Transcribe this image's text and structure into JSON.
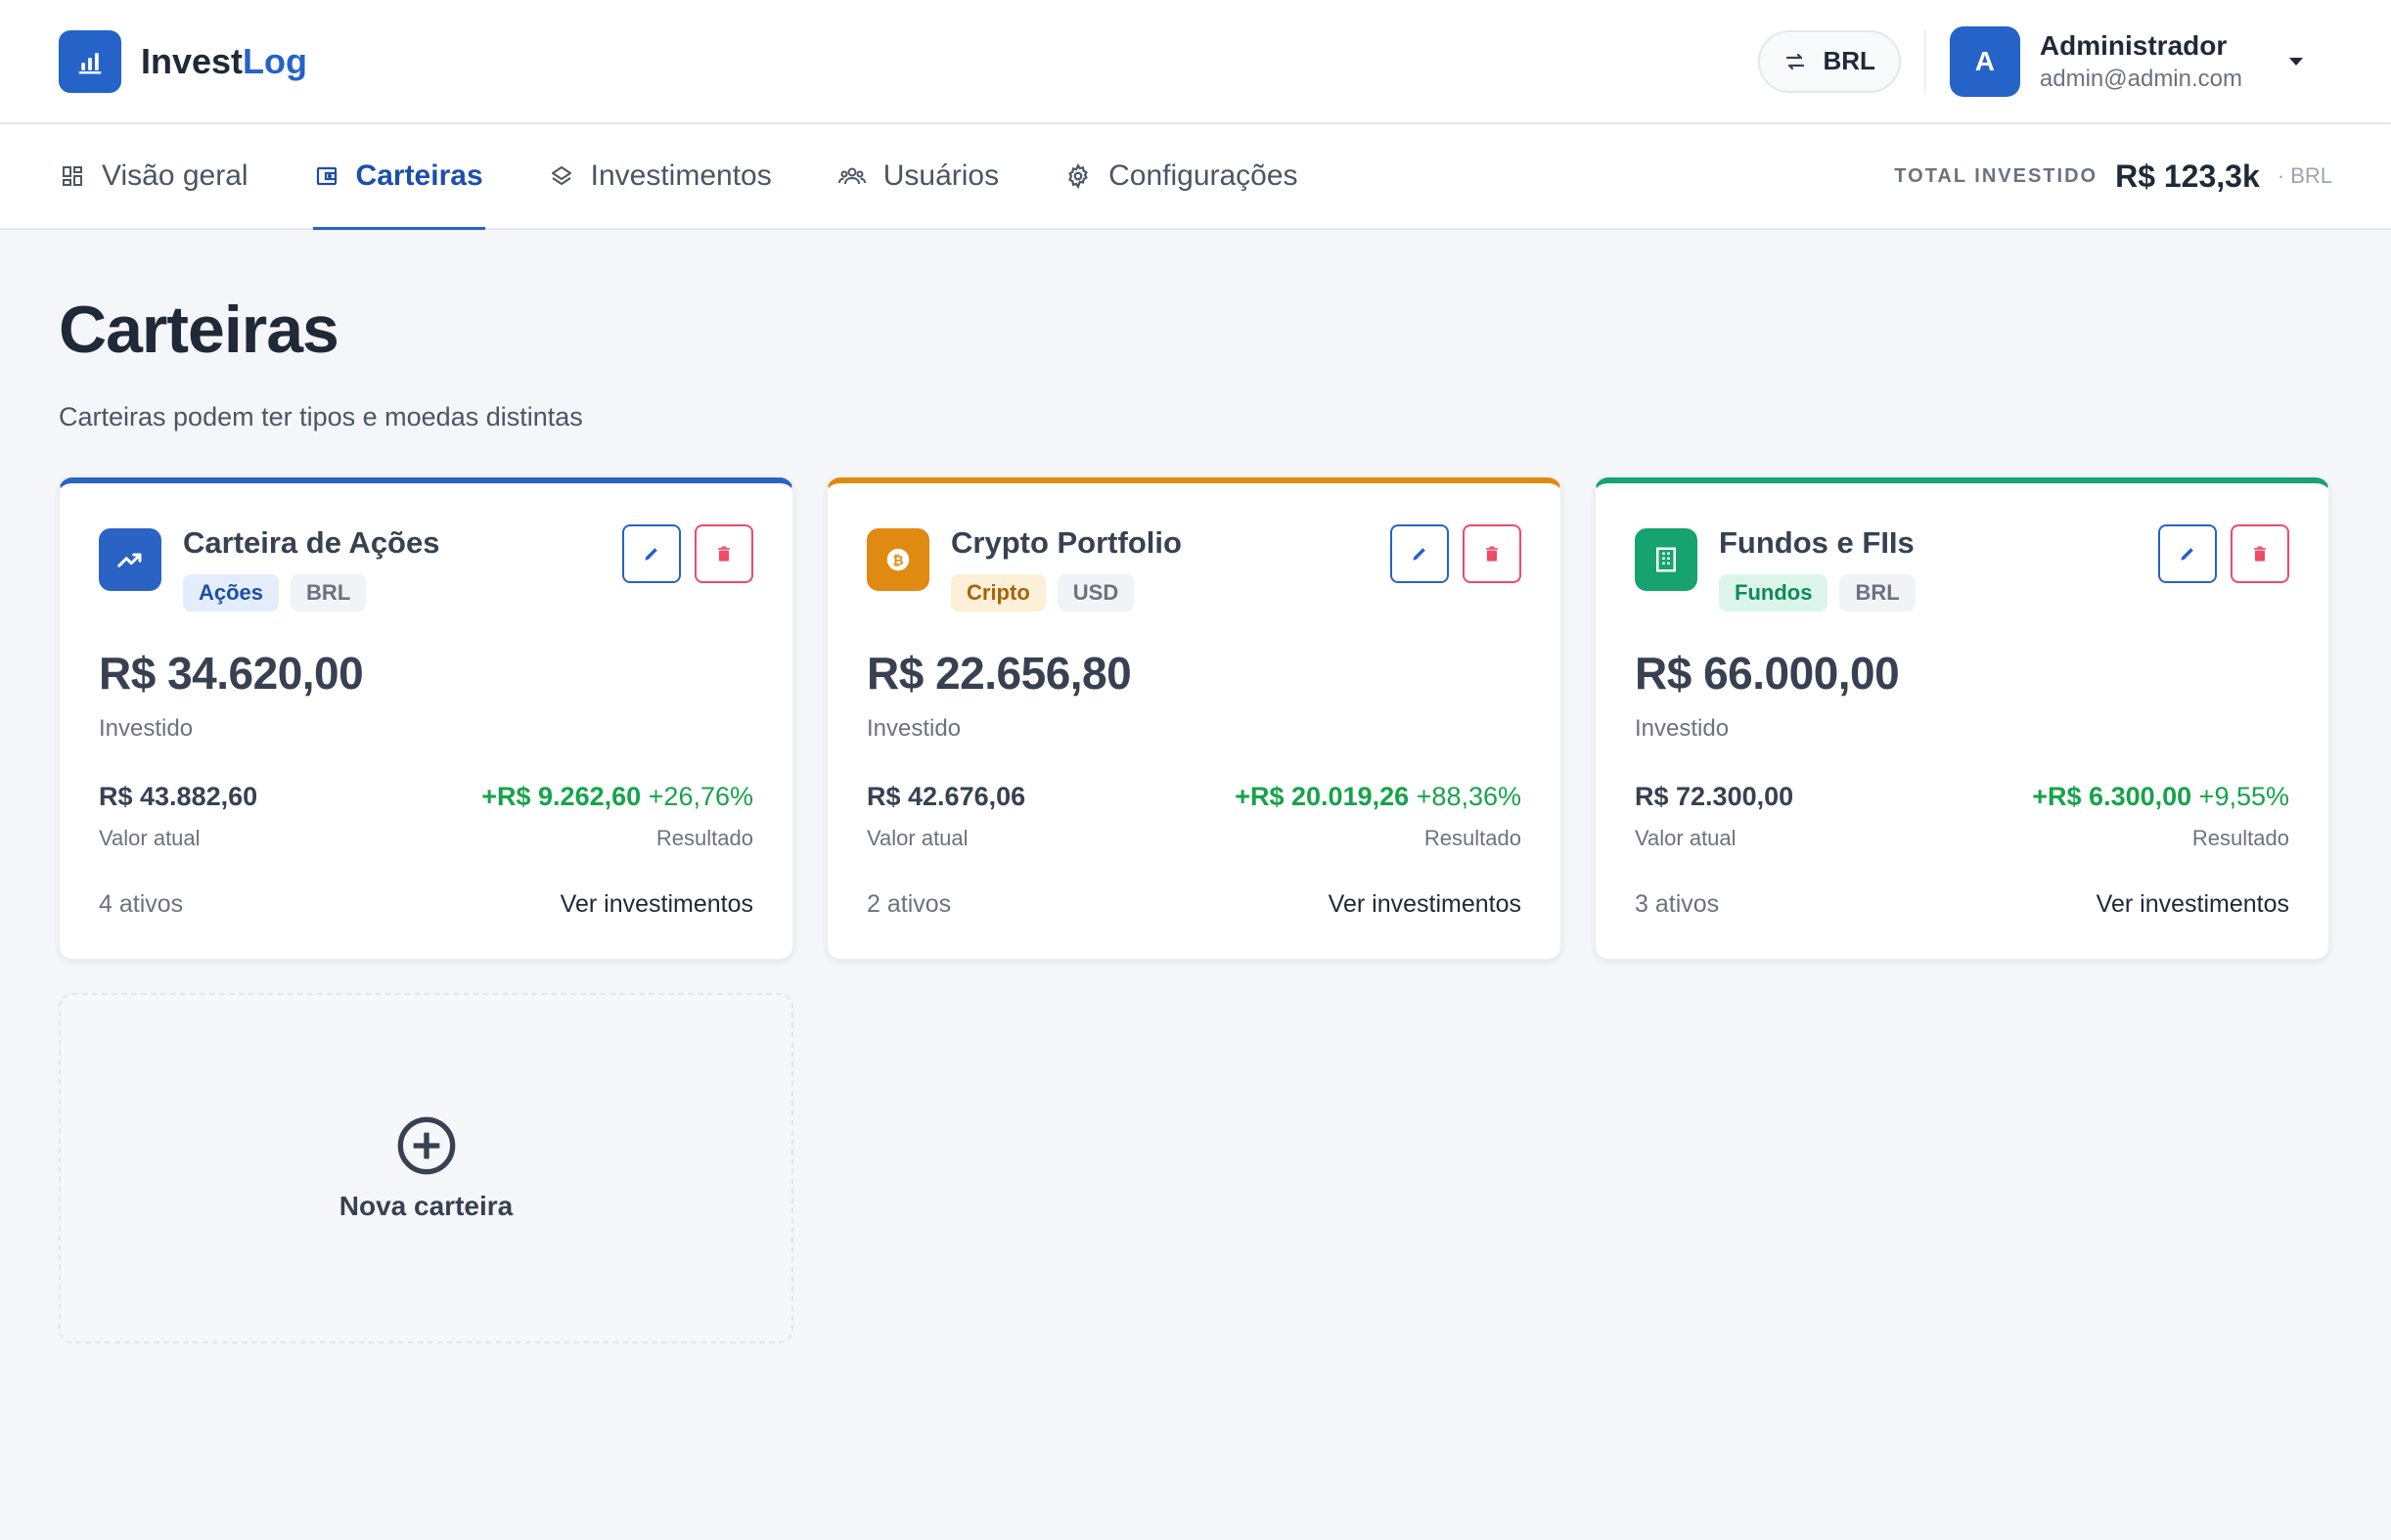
{
  "app": {
    "name_prefix": "Invest",
    "name_accent": "Log"
  },
  "header": {
    "currency_label": "BRL",
    "user": {
      "initial": "A",
      "name": "Administrador",
      "email": "admin@admin.com"
    }
  },
  "nav": {
    "tabs": [
      {
        "label": "Visão geral",
        "icon": "dashboard-icon",
        "active": false
      },
      {
        "label": "Carteiras",
        "icon": "wallet-icon",
        "active": true
      },
      {
        "label": "Investimentos",
        "icon": "layers-icon",
        "active": false
      },
      {
        "label": "Usuários",
        "icon": "users-icon",
        "active": false
      },
      {
        "label": "Configurações",
        "icon": "gear-icon",
        "active": false
      }
    ],
    "total_label": "TOTAL INVESTIDO",
    "total_value": "R$ 123,3k",
    "total_currency": "· BRL"
  },
  "page": {
    "title": "Carteiras",
    "subtitle": "Carteiras podem ter tipos e moedas distintas"
  },
  "colors": {
    "primary": "#2563c9",
    "acoes": "#2a63c4",
    "cripto": "#e08a12",
    "fundos": "#16a36f",
    "positive": "#16a34a",
    "danger": "#ef4a6a"
  },
  "wallets": [
    {
      "name": "Carteira de Ações",
      "icon": "trending-up-icon",
      "type_badge": "Ações",
      "currency_badge": "BRL",
      "invested": "R$ 34.620,00",
      "invested_label": "Investido",
      "current_value": "R$ 43.882,60",
      "current_label": "Valor atual",
      "result_value": "+R$ 9.262,60",
      "result_pct": "+26,76%",
      "result_label": "Resultado",
      "assets": "4 ativos",
      "link": "Ver investimentos"
    },
    {
      "name": "Crypto Portfolio",
      "icon": "bitcoin-icon",
      "type_badge": "Cripto",
      "currency_badge": "USD",
      "invested": "R$ 22.656,80",
      "invested_label": "Investido",
      "current_value": "R$ 42.676,06",
      "current_label": "Valor atual",
      "result_value": "+R$ 20.019,26",
      "result_pct": "+88,36%",
      "result_label": "Resultado",
      "assets": "2 ativos",
      "link": "Ver investimentos"
    },
    {
      "name": "Fundos e FIIs",
      "icon": "building-icon",
      "type_badge": "Fundos",
      "currency_badge": "BRL",
      "invested": "R$ 66.000,00",
      "invested_label": "Investido",
      "current_value": "R$ 72.300,00",
      "current_label": "Valor atual",
      "result_value": "+R$ 6.300,00",
      "result_pct": "+9,55%",
      "result_label": "Resultado",
      "assets": "3 ativos",
      "link": "Ver investimentos"
    }
  ],
  "new_wallet": {
    "label": "Nova carteira",
    "icon": "plus-circle-icon"
  }
}
